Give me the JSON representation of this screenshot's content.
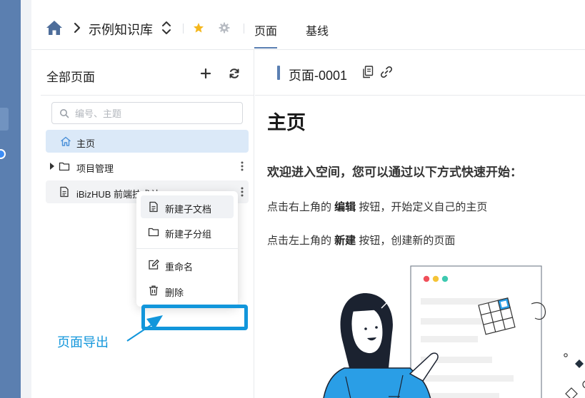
{
  "header": {
    "kb_title": "示例知识库",
    "tabs": [
      {
        "label": "页面",
        "active": true
      },
      {
        "label": "基线",
        "active": false
      }
    ]
  },
  "panel": {
    "title": "全部页面",
    "search_placeholder": "编号、主题",
    "tree": [
      {
        "label": "主页",
        "icon": "home-icon",
        "selected": true
      },
      {
        "label": "项目管理",
        "icon": "folder-icon",
        "expandable": true
      },
      {
        "label": "iBizHUB 前端技术站",
        "icon": "document-icon"
      }
    ]
  },
  "context_menu": {
    "items": [
      {
        "label": "新建子文档",
        "icon": "new-doc-icon"
      },
      {
        "label": "新建子分组",
        "icon": "folder-icon"
      },
      {
        "label": "重命名",
        "icon": "edit-icon"
      },
      {
        "label": "删除",
        "icon": "trash-icon"
      }
    ]
  },
  "annotation": {
    "text": "页面导出",
    "color": "#1296db"
  },
  "content": {
    "page_title": "页面-0001",
    "heading": "主页",
    "welcome": "欢迎进入空间，您可以通过以下方式快速开始：",
    "line1": {
      "before": "点击右上角的 ",
      "bold": "编辑",
      "after": " 按钮，开始定义自己的主页"
    },
    "line2": {
      "before": "点击左上角的 ",
      "bold": "新建",
      "after": " 按钮，创建新的页面"
    }
  },
  "colors": {
    "accent": "#5a7fb2",
    "selected_row": "#dbe9f8",
    "star": "#f5b71d",
    "left_strip": "#5b7fb0"
  }
}
